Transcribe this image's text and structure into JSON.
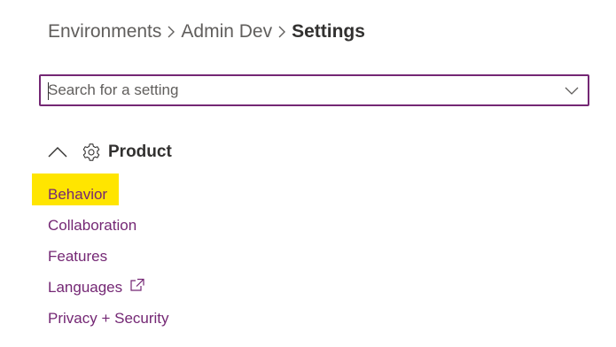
{
  "breadcrumb": {
    "items": [
      "Environments",
      "Admin Dev"
    ],
    "current": "Settings"
  },
  "search": {
    "placeholder": "Search for a setting",
    "value": ""
  },
  "section": {
    "title": "Product",
    "expanded": true,
    "icon": "gear-icon",
    "links": [
      {
        "label": "Behavior",
        "highlighted": true
      },
      {
        "label": "Collaboration"
      },
      {
        "label": "Features"
      },
      {
        "label": "Languages",
        "external": true
      },
      {
        "label": "Privacy + Security"
      }
    ]
  },
  "colors": {
    "accent": "#742774",
    "highlight": "#ffe500",
    "text": "#323130",
    "muted": "#605e5c"
  }
}
